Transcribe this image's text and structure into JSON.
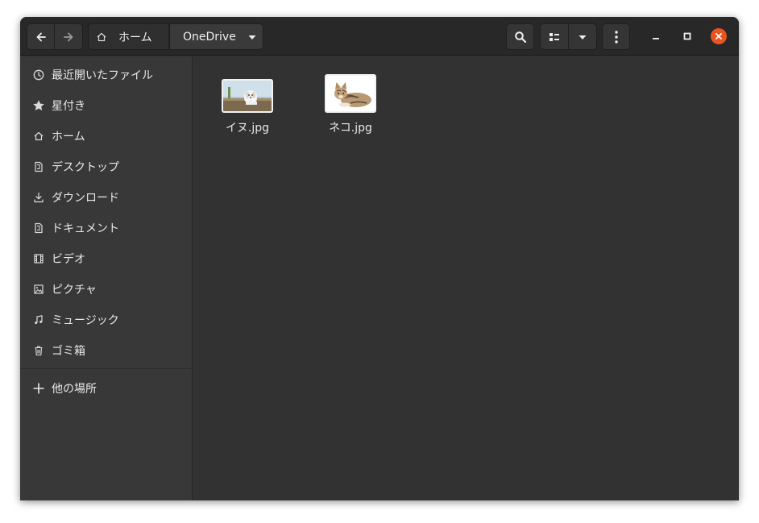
{
  "header": {
    "back_icon": "arrow-left-icon",
    "forward_icon": "arrow-right-icon",
    "breadcrumb": {
      "home_label": "ホーム",
      "current_label": "OneDrive"
    }
  },
  "sidebar": {
    "items": [
      {
        "label": "最近開いたファイル",
        "icon": "clock-icon"
      },
      {
        "label": "星付き",
        "icon": "star-icon"
      },
      {
        "label": "ホーム",
        "icon": "home-icon"
      },
      {
        "label": "デスクトップ",
        "icon": "folder-icon"
      },
      {
        "label": "ダウンロード",
        "icon": "download-icon"
      },
      {
        "label": "ドキュメント",
        "icon": "document-icon"
      },
      {
        "label": "ビデオ",
        "icon": "film-icon"
      },
      {
        "label": "ピクチャ",
        "icon": "image-icon"
      },
      {
        "label": "ミュージック",
        "icon": "music-icon"
      },
      {
        "label": "ゴミ箱",
        "icon": "trash-icon"
      }
    ],
    "other_locations": {
      "label": "他の場所",
      "icon": "plus-icon"
    }
  },
  "files": [
    {
      "name": "イヌ.jpg",
      "thumbnail": "dog-thumbnail"
    },
    {
      "name": "ネコ.jpg",
      "thumbnail": "cat-thumbnail"
    }
  ],
  "colors": {
    "close_button": "#e95420",
    "window_bg": "#2f2f2f",
    "sidebar_bg": "#383838"
  }
}
